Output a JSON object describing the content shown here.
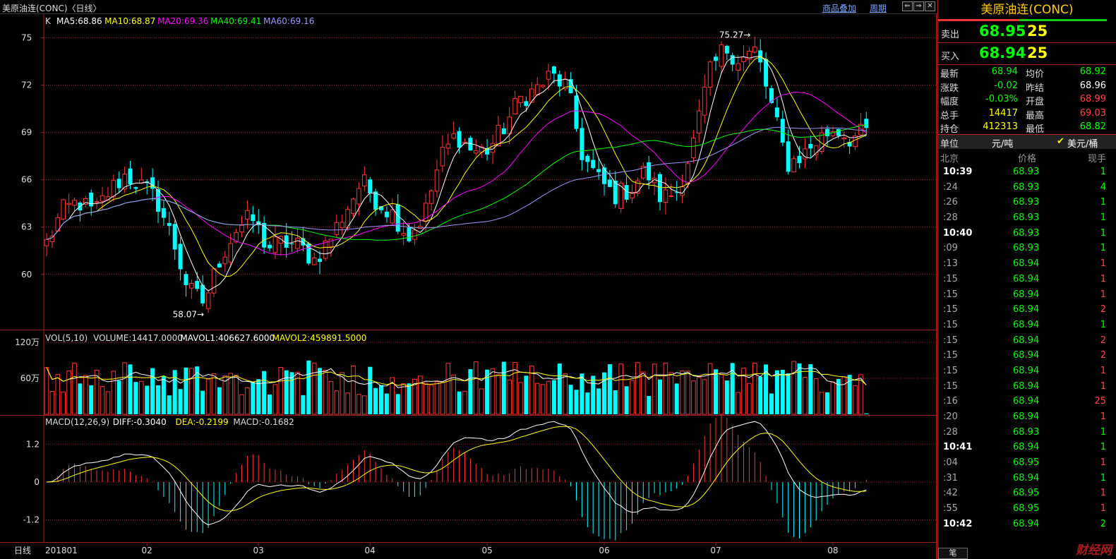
{
  "window": {
    "title": "美原油连(CONC)〈日线〉",
    "links": [
      "商品叠加",
      "周期"
    ],
    "nav_buttons": [
      "left-arrow",
      "right-arrow",
      "close"
    ]
  },
  "kline_legend": {
    "k": "K",
    "ma": [
      {
        "label": "MA5:68.86",
        "color": "#ffffff"
      },
      {
        "label": "MA10:68.87",
        "color": "#ffff00"
      },
      {
        "label": "MA20:69.36",
        "color": "#ff00ff"
      },
      {
        "label": "MA40:69.41",
        "color": "#00ff00"
      },
      {
        "label": "MA60:69.16",
        "color": "#9a9aff"
      }
    ]
  },
  "vol_legend": {
    "label": "VOL(5,10)",
    "volume": "VOLUME:14417.0000",
    "mavol1": "MAVOL1:406627.6000",
    "mavol2": "MAVOL2:459891.5000"
  },
  "macd_legend": {
    "label": "MACD(12,26,9)",
    "diff": "DIFF:-0.3040",
    "dea": "DEA:-0.2199",
    "macd": "MACD:-0.1682"
  },
  "colors": {
    "up": "#ff3232",
    "down": "#00ffff",
    "grid": "#a02020",
    "axis_text": "#dddddd"
  },
  "chart_data": {
    "type": "candlestick",
    "price_axis": {
      "ylim": [
        56.5,
        76.5
      ],
      "ticks": [
        "75",
        "72",
        "69",
        "66",
        "63",
        "60"
      ]
    },
    "vol_axis": {
      "ylim": [
        0,
        140
      ],
      "ticks": [
        "120万",
        "60万"
      ]
    },
    "macd_axis": {
      "ylim": [
        -1.9,
        2.1
      ],
      "ticks": [
        "1.2",
        "0",
        "-1.2"
      ]
    },
    "period_label": "日线",
    "x_labels": [
      "201801",
      "02",
      "03",
      "04",
      "05",
      "06",
      "07",
      "08"
    ],
    "annotations": [
      {
        "text": "75.27",
        "price": 75.27
      },
      {
        "text": "58.07",
        "price": 58.07
      }
    ],
    "waypoints": [
      62.0,
      64.0,
      64.6,
      63.9,
      65.3,
      66.3,
      65.6,
      64.7,
      62.2,
      59.0,
      58.2,
      61.0,
      62.8,
      63.6,
      61.7,
      62.0,
      61.8,
      60.9,
      62.3,
      64.1,
      65.9,
      64.6,
      63.8,
      62.4,
      63.9,
      67.4,
      68.9,
      67.8,
      67.9,
      69.3,
      71.1,
      71.7,
      72.6,
      71.9,
      67.5,
      66.0,
      65.0,
      65.4,
      66.6,
      64.8,
      65.3,
      68.2,
      72.6,
      74.4,
      73.6,
      74.2,
      70.6,
      67.0,
      67.6,
      68.6,
      69.3,
      68.6,
      69.0
    ]
  },
  "quote": {
    "title": "美原油连(CONC)",
    "sell": {
      "label": "卖出",
      "price": "68.95",
      "qty": "25"
    },
    "buy": {
      "label": "买入",
      "price": "68.94",
      "qty": "25"
    },
    "stats": [
      {
        "l1": "最新",
        "v1": "68.94",
        "c1": "#00ff00",
        "l2": "均价",
        "v2": "68.92",
        "c2": "#00ff00"
      },
      {
        "l1": "涨跌",
        "v1": "-0.02",
        "c1": "#00ff00",
        "l2": "昨结",
        "v2": "68.96",
        "c2": "#ffffff"
      },
      {
        "l1": "幅度",
        "v1": "-0.03%",
        "c1": "#00ff00",
        "l2": "开盘",
        "v2": "68.99",
        "c2": "#ff4444"
      },
      {
        "l1": "总手",
        "v1": "14417",
        "c1": "#ffff00",
        "l2": "最高",
        "v2": "69.03",
        "c2": "#ff4444"
      },
      {
        "l1": "持仓",
        "v1": "412313",
        "c1": "#ffff00",
        "l2": "最低",
        "v2": "68.82",
        "c2": "#00ff00"
      }
    ],
    "unit": {
      "label": "单位",
      "value": "元/吨",
      "check": "✔",
      "option": "美元/桶"
    },
    "ticks_header": {
      "time": "北京",
      "price": "价格",
      "qty": "现手"
    },
    "ticks": [
      {
        "time": "10:39",
        "price": "68.93",
        "qty": "1",
        "up": false
      },
      {
        "time": ":24",
        "price": "68.93",
        "qty": "4",
        "up": false
      },
      {
        "time": ":26",
        "price": "68.93",
        "qty": "1",
        "up": false
      },
      {
        "time": ":28",
        "price": "68.93",
        "qty": "1",
        "up": false
      },
      {
        "time": "10:40",
        "price": "68.93",
        "qty": "1",
        "up": false
      },
      {
        "time": ":09",
        "price": "68.93",
        "qty": "1",
        "up": false
      },
      {
        "time": ":13",
        "price": "68.94",
        "qty": "1",
        "up": true
      },
      {
        "time": ":15",
        "price": "68.94",
        "qty": "1",
        "up": true
      },
      {
        "time": ":15",
        "price": "68.94",
        "qty": "1",
        "up": true
      },
      {
        "time": ":15",
        "price": "68.94",
        "qty": "2",
        "up": true
      },
      {
        "time": ":15",
        "price": "68.94",
        "qty": "1",
        "up": false
      },
      {
        "time": ":15",
        "price": "68.94",
        "qty": "2",
        "up": true
      },
      {
        "time": ":15",
        "price": "68.94",
        "qty": "2",
        "up": true
      },
      {
        "time": ":15",
        "price": "68.94",
        "qty": "1",
        "up": true
      },
      {
        "time": ":15",
        "price": "68.94",
        "qty": "1",
        "up": true
      },
      {
        "time": ":16",
        "price": "68.94",
        "qty": "25",
        "up": true
      },
      {
        "time": ":20",
        "price": "68.94",
        "qty": "1",
        "up": true
      },
      {
        "time": ":28",
        "price": "68.93",
        "qty": "1",
        "up": false
      },
      {
        "time": "10:41",
        "price": "68.94",
        "qty": "1",
        "up": false
      },
      {
        "time": ":04",
        "price": "68.95",
        "qty": "1",
        "up": true
      },
      {
        "time": ":31",
        "price": "68.94",
        "qty": "1",
        "up": false
      },
      {
        "time": ":42",
        "price": "68.95",
        "qty": "1",
        "up": true
      },
      {
        "time": ":55",
        "price": "68.95",
        "qty": "1",
        "up": true
      },
      {
        "time": "10:42",
        "price": "68.94",
        "qty": "2",
        "up": false
      }
    ],
    "tab_label": "笔",
    "watermark": "财经网"
  }
}
